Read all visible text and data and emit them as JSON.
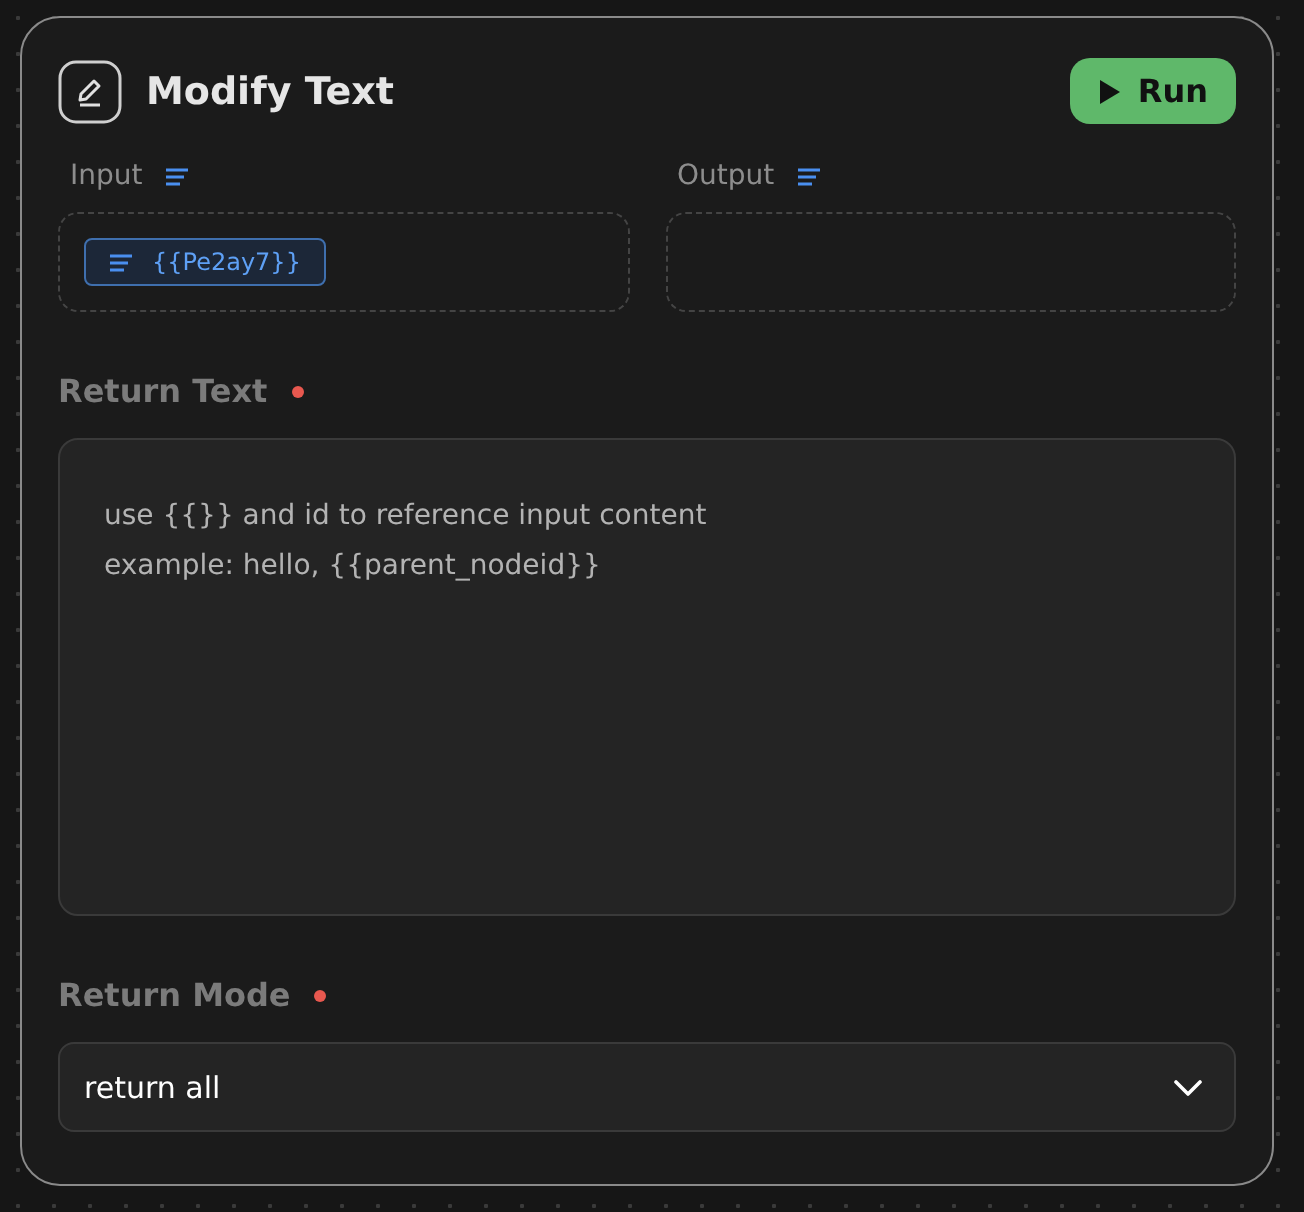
{
  "node": {
    "title": "Modify Text",
    "run_button": "Run"
  },
  "io": [
    {
      "label": "Input",
      "tags": [
        "{{Pe2ay7}}"
      ]
    },
    {
      "label": "Output"
    }
  ],
  "return_text": {
    "label": "Return Text",
    "required": true,
    "placeholder": "use {{}} and id to reference input content\nexample: hello, {{parent_nodeid}}"
  },
  "return_mode": {
    "label": "Return Mode",
    "required": true,
    "value": "return all"
  }
}
